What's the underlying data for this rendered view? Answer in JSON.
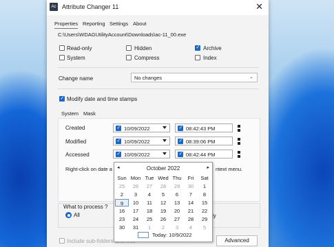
{
  "window": {
    "app_icon": "Ac",
    "title": "Attribute Changer 11",
    "close_glyph": "✕"
  },
  "menu": [
    "Properties",
    "Reporting",
    "Settings",
    "About"
  ],
  "file_path": "C:\\Users\\WDAGUtilityAccount\\Downloads\\ac-11_00.exe",
  "attributes": [
    {
      "label": "Read-only",
      "checked": false
    },
    {
      "label": "Hidden",
      "checked": false
    },
    {
      "label": "Archive",
      "checked": true
    },
    {
      "label": "System",
      "checked": false
    },
    {
      "label": "Compress",
      "checked": false
    },
    {
      "label": "Index",
      "checked": false
    }
  ],
  "change_name": {
    "label": "Change name",
    "value": "No changes"
  },
  "modify_dates": {
    "label": "Modify date and time stamps",
    "checked": true
  },
  "tabs": [
    "System",
    "Mask"
  ],
  "timestamps": [
    {
      "label": "Created",
      "date": "10/09/2022",
      "time": "08:42:43  PM"
    },
    {
      "label": "Modified",
      "date": "10/09/2022",
      "time": "08:39:06  PM"
    },
    {
      "label": "Accessed",
      "date": "10/09/2022",
      "time": "08:42:44  PM"
    }
  ],
  "hint": {
    "left": "Right-click on date a",
    "right": "ntext menu."
  },
  "calendar": {
    "prev": "◂",
    "next": "▸",
    "title": "October 2022",
    "weekdays": [
      "Sun",
      "Mon",
      "Tue",
      "Wed",
      "Thu",
      "Fri",
      "Sat"
    ],
    "weeks": [
      [
        "25",
        "26",
        "27",
        "28",
        "29",
        "30",
        "1"
      ],
      [
        "2",
        "3",
        "4",
        "5",
        "6",
        "7",
        "8"
      ],
      [
        "9",
        "10",
        "11",
        "12",
        "13",
        "14",
        "15"
      ],
      [
        "16",
        "17",
        "18",
        "19",
        "20",
        "21",
        "22"
      ],
      [
        "23",
        "24",
        "25",
        "26",
        "27",
        "28",
        "29"
      ],
      [
        "30",
        "31",
        "1",
        "2",
        "3",
        "4",
        "5"
      ]
    ],
    "selected": "9",
    "today_label": "Today: 10/9/2022"
  },
  "process": {
    "label": "What to process ?",
    "option": "All",
    "right_fragment": "ly"
  },
  "subfolders_label": "Include sub-folders and files",
  "advanced_button": "Advanced"
}
